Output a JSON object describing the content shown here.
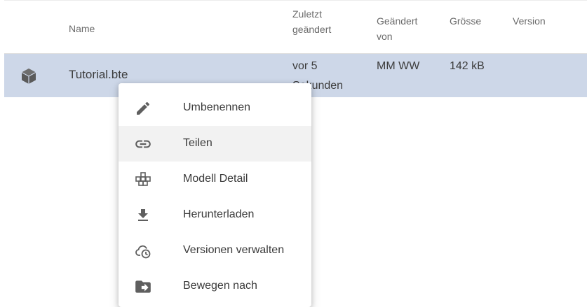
{
  "table": {
    "headers": {
      "name": "Name",
      "modified": "Zuletzt geändert",
      "modified_by": "Geändert von",
      "size": "Grösse",
      "version": "Version"
    },
    "rows": [
      {
        "icon": "cube-icon",
        "name": "Tutorial.bte",
        "modified": "vor 5 Sekunden",
        "modified_by": "MM WW",
        "size": "142 kB",
        "version": ""
      }
    ]
  },
  "context_menu": {
    "items": [
      {
        "label": "Umbenennen",
        "icon": "pencil-icon"
      },
      {
        "label": "Teilen",
        "icon": "link-icon",
        "hovered": true
      },
      {
        "label": "Modell Detail",
        "icon": "model-structure-icon"
      },
      {
        "label": "Herunterladen",
        "icon": "download-icon"
      },
      {
        "label": "Versionen verwalten",
        "icon": "cloud-history-icon"
      },
      {
        "label": "Bewegen nach",
        "icon": "folder-move-icon"
      }
    ]
  },
  "colors": {
    "selected_row": "#cdd7e8",
    "menu_hover": "#f2f2f2",
    "icon_gray": "#5f5f5f",
    "header_text": "#6a6a6a"
  }
}
